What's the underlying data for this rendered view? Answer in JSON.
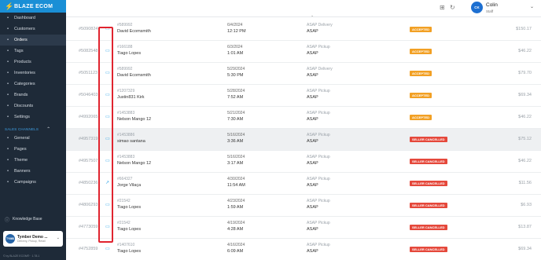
{
  "brand": {
    "name": "BLAZE ECOM",
    "color": "#1a8fd6"
  },
  "sidebar": {
    "items": [
      {
        "label": "Dashboard",
        "icon": "dashboard-icon"
      },
      {
        "label": "Customers",
        "icon": "customers-icon"
      },
      {
        "label": "Orders",
        "icon": "orders-icon",
        "active": true
      },
      {
        "label": "Tags",
        "icon": "tag-icon"
      },
      {
        "label": "Products",
        "icon": "products-icon"
      },
      {
        "label": "Inventories",
        "icon": "inventory-icon"
      },
      {
        "label": "Categories",
        "icon": "categories-icon"
      },
      {
        "label": "Brands",
        "icon": "brands-icon"
      },
      {
        "label": "Discounts",
        "icon": "discount-icon"
      },
      {
        "label": "Settings",
        "icon": "gear-icon"
      }
    ],
    "section_label": "SALES CHANNELS",
    "channel_items": [
      {
        "label": "General",
        "icon": "general-icon"
      },
      {
        "label": "Pages",
        "icon": "pages-icon"
      },
      {
        "label": "Theme",
        "icon": "theme-icon"
      },
      {
        "label": "Banners",
        "icon": "banners-icon"
      },
      {
        "label": "Campaigns",
        "icon": "campaigns-icon"
      }
    ],
    "knowledge_base": "Knowledge Base",
    "store": {
      "logo": "TYMB",
      "name": "Tymber Demo ...",
      "sub": "Delivery, Pickup, Retail"
    },
    "version": "© by BLAZE ECOM® · 1.78.1"
  },
  "topbar": {
    "user_initials": "CK",
    "user_name": "Colin",
    "user_role": "Staff",
    "avatar_color": "#1d6fd1"
  },
  "orders": [
    {
      "id": "#5090824",
      "cust_id": "#589992",
      "name": "David Ecomsmith",
      "date": "6/4/2024",
      "time": "12:12 PM",
      "type": "ASAP Delivery",
      "when": "ASAP",
      "status": "ACCEPTED",
      "amount": "$150.17"
    },
    {
      "id": "#5082548",
      "cust_id": "#166188",
      "name": "Tiago Lopes",
      "date": "6/3/2024",
      "time": "1:01 AM",
      "type": "ASAP Pickup",
      "when": "ASAP",
      "status": "ACCEPTED",
      "amount": "$46.22"
    },
    {
      "id": "#5051123",
      "cust_id": "#589992",
      "name": "David Ecomsmith",
      "date": "5/29/2024",
      "time": "5:30 PM",
      "type": "ASAP Delivery",
      "when": "ASAP",
      "status": "ACCEPTED",
      "amount": "$79.70"
    },
    {
      "id": "#5046403",
      "cust_id": "#1207329",
      "name": "Justin831 Kirk",
      "date": "5/28/2024",
      "time": "7:52 AM",
      "type": "ASAP Pickup",
      "when": "ASAP",
      "status": "ACCEPTED",
      "amount": "$69.34"
    },
    {
      "id": "#4992065",
      "cust_id": "#1453883",
      "name": "Nelson Mango 12",
      "date": "5/21/2024",
      "time": "7:30 AM",
      "type": "ASAP Pickup",
      "when": "ASAP",
      "status": "ACCEPTED",
      "amount": "$46.22"
    },
    {
      "id": "#4957319",
      "cust_id": "#1453886",
      "name": "simao santana",
      "date": "5/16/2024",
      "time": "3:36 AM",
      "type": "ASAP Pickup",
      "when": "ASAP",
      "status": "SELLER CANCELLED",
      "amount": "$75.12"
    },
    {
      "id": "#4957507",
      "cust_id": "#1453883",
      "name": "Nelson Mango 12",
      "date": "5/16/2024",
      "time": "3:17 AM",
      "type": "ASAP Pickup",
      "when": "ASAP",
      "status": "SELLER CANCELLED",
      "amount": "$46.22"
    },
    {
      "id": "#4850236",
      "cust_id": "#664327",
      "name": "Jorge Vilaça",
      "date": "4/30/2024",
      "time": "11:54 AM",
      "type": "ASAP Pickup",
      "when": "ASAP",
      "status": "SELLER CANCELLED",
      "amount": "$11.56"
    },
    {
      "id": "#4806293",
      "cust_id": "#21542",
      "name": "Tiago Lopes",
      "date": "4/23/2024",
      "time": "1:59 AM",
      "type": "ASAP Pickup",
      "when": "ASAP",
      "status": "SELLER CANCELLED",
      "amount": "$6.93"
    },
    {
      "id": "#4773059",
      "cust_id": "#21542",
      "name": "Tiago Lopes",
      "date": "4/19/2024",
      "time": "4:28 AM",
      "type": "ASAP Pickup",
      "when": "ASAP",
      "status": "SELLER CANCELLED",
      "amount": "$13.87"
    },
    {
      "id": "#4752859",
      "cust_id": "#1407610",
      "name": "Tiago Lopes",
      "date": "4/16/2024",
      "time": "6:09 AM",
      "type": "ASAP Pickup",
      "when": "ASAP",
      "status": "SELLER CANCELLED",
      "amount": "$69.34"
    }
  ],
  "status_colors": {
    "ACCEPTED": "#f2a024",
    "SELLER CANCELLED": "#e5483b"
  },
  "highlight_color": "#e0242f"
}
